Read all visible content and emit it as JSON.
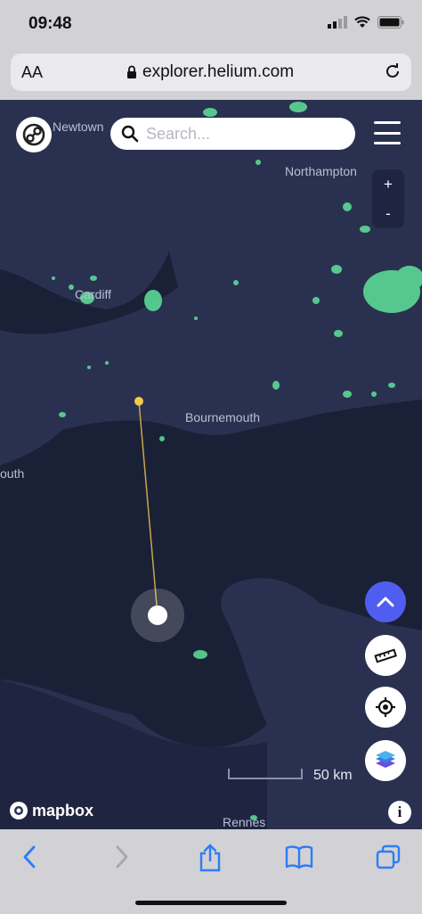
{
  "status": {
    "time": "09:48"
  },
  "browser": {
    "text_size_label": "AA",
    "url": "explorer.helium.com"
  },
  "search": {
    "placeholder": "Search..."
  },
  "map": {
    "labels": {
      "newtown": "Newtown",
      "northampton": "Northampton",
      "cardiff": "Cardiff",
      "bournemouth": "Bournemouth",
      "plymouth_partial": "outh",
      "rennes": "Rennes"
    },
    "zoom_in": "+",
    "zoom_out": "-",
    "scale": "50 km",
    "attribution": "mapbox",
    "info": "i"
  },
  "colors": {
    "sea": "#1a2036",
    "land": "#2a3150",
    "hotspot": "#5ee39a",
    "accent": "#4f5ef0",
    "link_line": "#c9a64a"
  },
  "icons": {
    "logo": "helium-logo-icon",
    "search": "search-icon",
    "menu": "hamburger-menu-icon",
    "up": "chevron-up-icon",
    "ruler": "ruler-icon",
    "locate": "crosshair-icon",
    "layers": "layers-icon",
    "back": "chevron-left-icon",
    "forward": "chevron-right-icon",
    "share": "share-icon",
    "bookmarks": "book-icon",
    "tabs": "tabs-icon"
  }
}
